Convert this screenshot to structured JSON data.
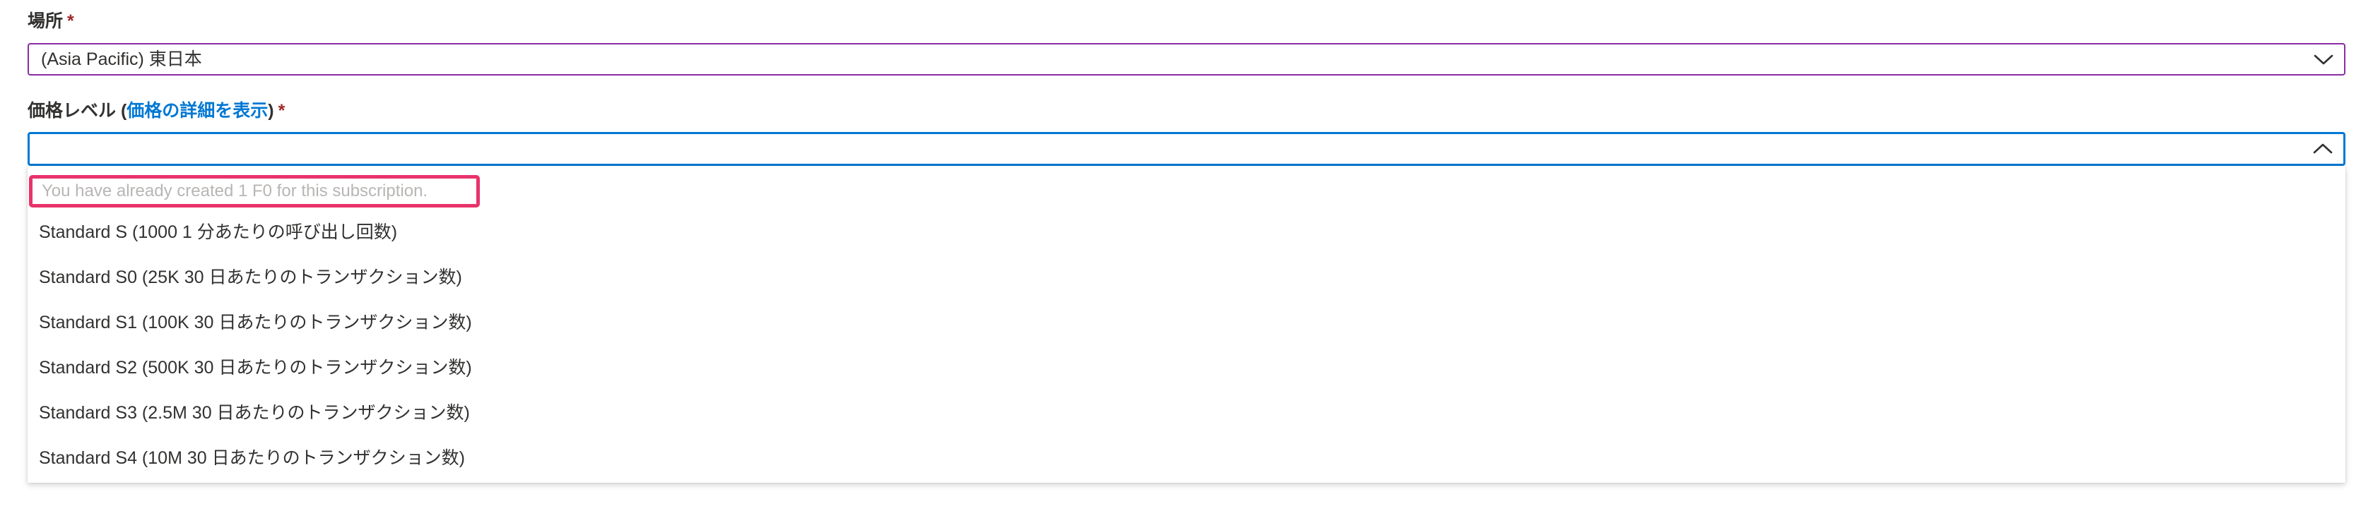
{
  "location": {
    "label": "場所",
    "required_mark": "*",
    "value": "(Asia Pacific) 東日本",
    "chevron_icon": "chevron-down-icon"
  },
  "pricing_tier": {
    "label_prefix": "価格レベル (",
    "link_text": "価格の詳細を表示",
    "label_suffix": ")",
    "required_mark": "*",
    "value": "",
    "chevron_icon": "chevron-up-icon",
    "disabled_note": "You have already created 1 F0 for this subscription.",
    "options": [
      "Standard S (1000 1 分あたりの呼び出し回数)",
      "Standard S0 (25K 30 日あたりのトランザクション数)",
      "Standard S1 (100K 30 日あたりのトランザクション数)",
      "Standard S2 (500K 30 日あたりのトランザクション数)",
      "Standard S3 (2.5M 30 日あたりのトランザクション数)",
      "Standard S4 (10M 30 日あたりのトランザクション数)"
    ]
  },
  "colors": {
    "accent": "#0078d4",
    "focus_border_location": "#8a2da5",
    "required": "#a4262c",
    "highlight_box": "#e8336b"
  }
}
